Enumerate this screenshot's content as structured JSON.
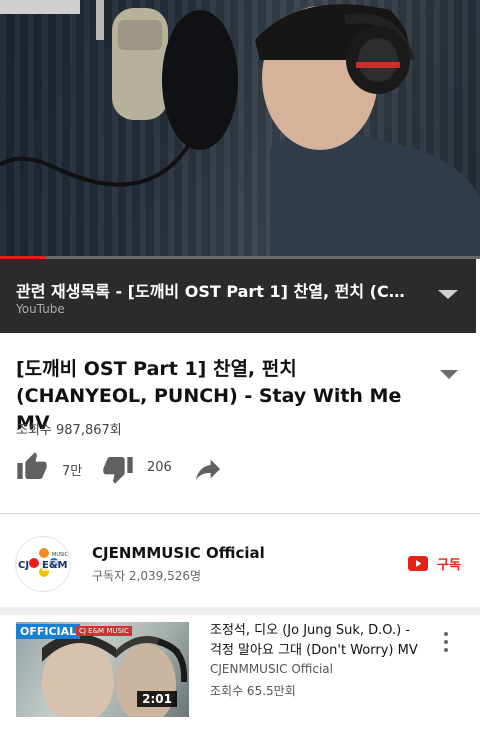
{
  "player": {
    "progress_fraction": 0.096
  },
  "playlist": {
    "title": "관련 재생목록 - [도깨비 OST Part 1] 찬열, 펀치 (CHANYEOL, PUNCH) - Stay With Me MV",
    "source": "YouTube"
  },
  "video": {
    "title": "[도깨비 OST Part 1] 찬열, 펀치 (CHANYEOL, PUNCH) - Stay With Me MV",
    "views": "조회수 987,867회",
    "likes": "7만",
    "dislikes": "206"
  },
  "channel": {
    "name": "CJENMMUSIC Official",
    "subscribers": "구독자 2,039,526명",
    "subscribe_label": "구독",
    "avatar_text_left": "CJ",
    "avatar_text_right": "E&M",
    "avatar_text_small": "MUSIC"
  },
  "related": {
    "tag": "OFFICIAL",
    "sub_tag": "CJ E&M MUSIC",
    "duration": "2:01",
    "title": "조정석, 디오 (Jo Jung Suk, D.O.) - 걱정 말아요 그대 (Don't Worry) MV",
    "channel": "CJENMMUSIC Official",
    "views": "조회수 65.5만회"
  },
  "colors": {
    "accent_red": "#e62117",
    "playlist_bg": "#2b2b2b",
    "icon_gray": "#606060"
  }
}
